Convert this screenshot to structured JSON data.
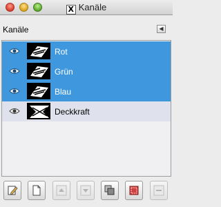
{
  "window": {
    "title": "Kanäle",
    "app_icon": "x11-icon"
  },
  "dock": {
    "title": "Kanäle",
    "menu_icon": "tab-menu-icon"
  },
  "channels": [
    {
      "name": "Rot",
      "visible": true,
      "selected": true
    },
    {
      "name": "Grün",
      "visible": true,
      "selected": true
    },
    {
      "name": "Blau",
      "visible": true,
      "selected": true
    },
    {
      "name": "Deckkraft",
      "visible": true,
      "selected": false
    }
  ],
  "toolbar": [
    {
      "icon": "edit-channel-icon",
      "enabled": true
    },
    {
      "icon": "new-channel-icon",
      "enabled": true
    },
    {
      "icon": "raise-channel-icon",
      "enabled": false
    },
    {
      "icon": "lower-channel-icon",
      "enabled": false
    },
    {
      "icon": "duplicate-channel-icon",
      "enabled": true
    },
    {
      "icon": "channel-to-selection-icon",
      "enabled": true
    },
    {
      "icon": "delete-channel-icon",
      "enabled": false
    }
  ],
  "colors": {
    "selected_row": "#3f98dd",
    "unselected_row": "#dfe2ec",
    "list_background": "#f0f0f3"
  }
}
